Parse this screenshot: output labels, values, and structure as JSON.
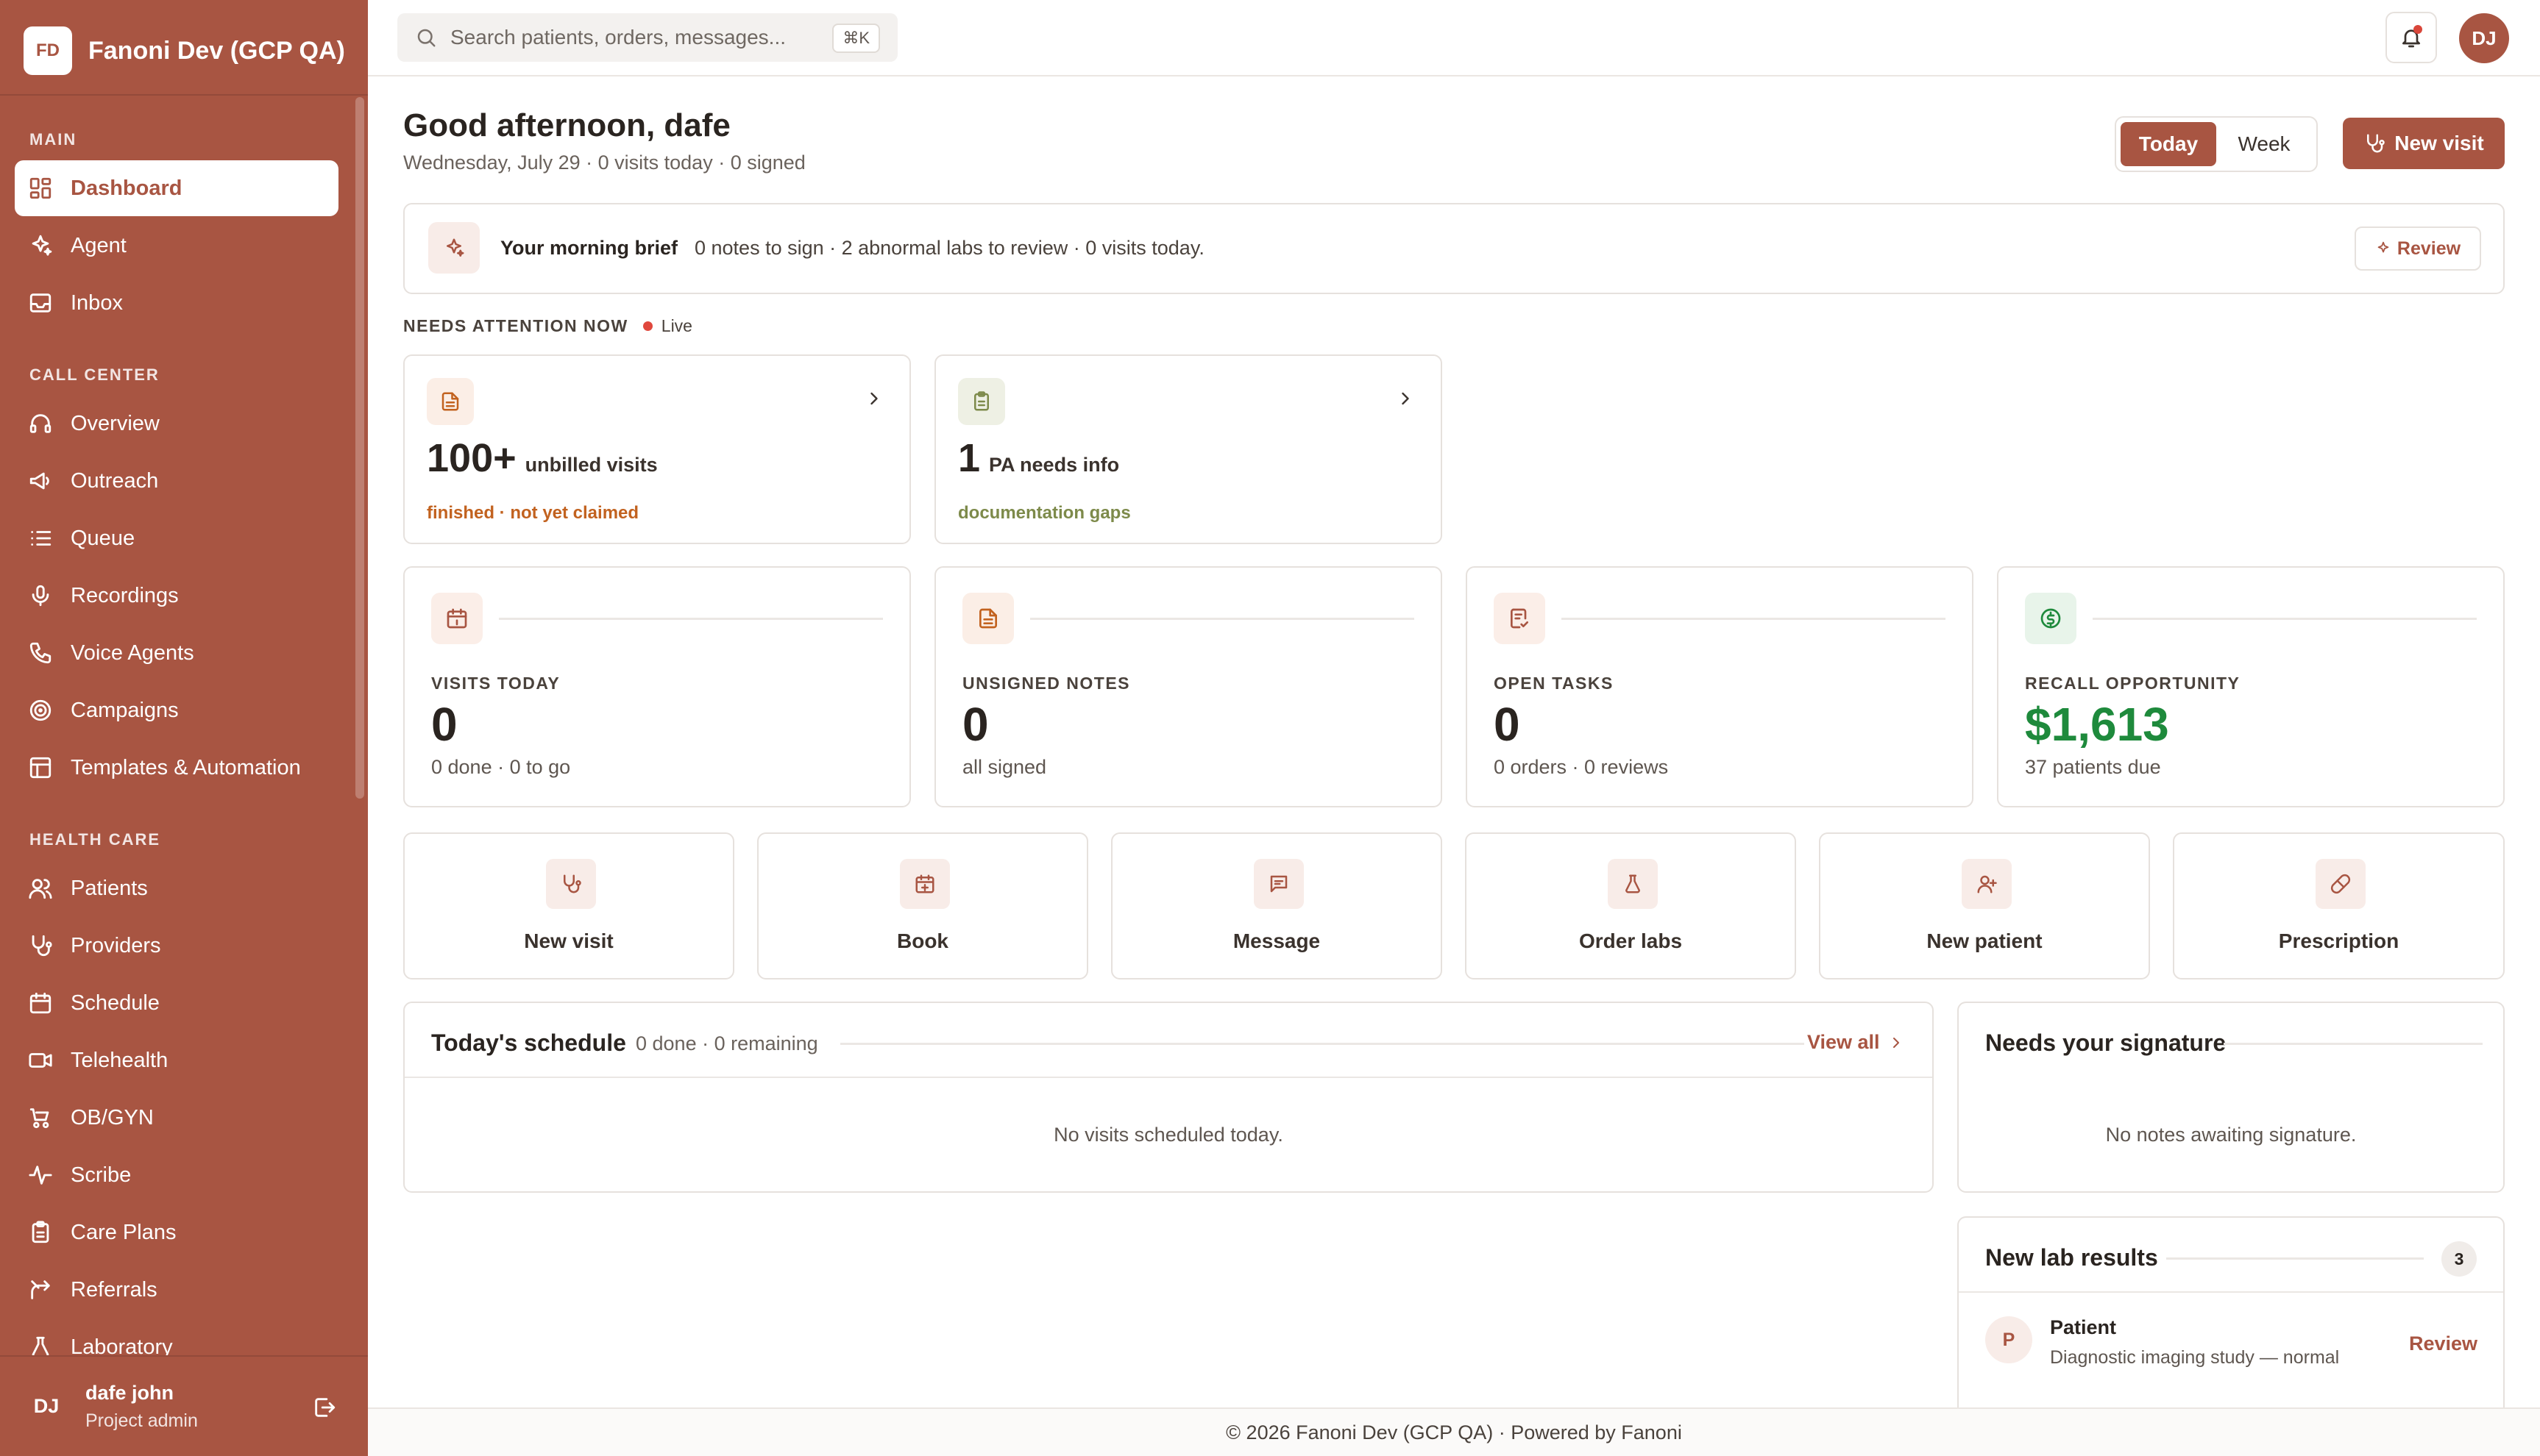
{
  "org": {
    "initials": "FD",
    "name": "Fanoni Dev (GCP QA)"
  },
  "sidebar": {
    "sections": {
      "main": "MAIN",
      "call_center": "CALL CENTER",
      "health_care": "HEALTH CARE"
    },
    "main_items": [
      {
        "label": "Dashboard",
        "icon": "dashboard-icon",
        "active": true
      },
      {
        "label": "Agent",
        "icon": "sparkle-icon"
      },
      {
        "label": "Inbox",
        "icon": "inbox-icon"
      }
    ],
    "call_items": [
      {
        "label": "Overview",
        "icon": "headset-icon"
      },
      {
        "label": "Outreach",
        "icon": "megaphone-icon"
      },
      {
        "label": "Queue",
        "icon": "list-icon"
      },
      {
        "label": "Recordings",
        "icon": "microphone-icon"
      },
      {
        "label": "Voice Agents",
        "icon": "phone-icon"
      },
      {
        "label": "Campaigns",
        "icon": "target-icon"
      },
      {
        "label": "Templates & Automation",
        "icon": "template-icon"
      }
    ],
    "health_items": [
      {
        "label": "Patients",
        "icon": "users-icon"
      },
      {
        "label": "Providers",
        "icon": "stethoscope-icon"
      },
      {
        "label": "Schedule",
        "icon": "calendar-icon"
      },
      {
        "label": "Telehealth",
        "icon": "video-icon"
      },
      {
        "label": "OB/GYN",
        "icon": "stroller-icon"
      },
      {
        "label": "Scribe",
        "icon": "waveform-icon"
      },
      {
        "label": "Care Plans",
        "icon": "clipboard-icon"
      },
      {
        "label": "Referrals",
        "icon": "split-arrow-icon"
      },
      {
        "label": "Laboratory",
        "icon": "flask-icon"
      }
    ]
  },
  "user": {
    "initials": "DJ",
    "name": "dafe john",
    "role": "Project admin"
  },
  "topbar": {
    "search_placeholder": "Search patients, orders, messages...",
    "shortcut": "⌘K",
    "avatar": "DJ"
  },
  "header": {
    "greeting": "Good afternoon, dafe",
    "subtitle": "Wednesday, July 29 · 0 visits today · 0 signed",
    "range_today": "Today",
    "range_week": "Week",
    "new_visit": "New visit"
  },
  "brief": {
    "title": "Your morning brief",
    "text": "0 notes to sign · 2 abnormal labs to review · 0 visits today.",
    "review": "Review"
  },
  "attention": {
    "label": "NEEDS ATTENTION NOW",
    "live": "Live",
    "cards": [
      {
        "value": "100+",
        "label": "unbilled visits",
        "sub": "finished · not yet claimed",
        "color": "#c2621f"
      },
      {
        "value": "1",
        "label": "PA needs info",
        "sub": "documentation gaps",
        "color": "#7d8a4a"
      }
    ]
  },
  "stats": [
    {
      "label": "VISITS TODAY",
      "value": "0",
      "sub": "0 done · 0 to go"
    },
    {
      "label": "UNSIGNED NOTES",
      "value": "0",
      "sub": "all signed"
    },
    {
      "label": "OPEN TASKS",
      "value": "0",
      "sub": "0 orders · 0 reviews"
    },
    {
      "label": "RECALL OPPORTUNITY",
      "value": "$1,613",
      "sub": "37 patients due",
      "color": "#1e8a3c"
    }
  ],
  "quick_actions": [
    "New visit",
    "Book",
    "Message",
    "Order labs",
    "New patient",
    "Prescription"
  ],
  "schedule": {
    "title": "Today's schedule",
    "sub": "0 done · 0 remaining",
    "view_all": "View all",
    "empty": "No visits scheduled today."
  },
  "signature": {
    "title": "Needs your signature",
    "empty": "No notes awaiting signature."
  },
  "labs": {
    "title": "New lab results",
    "count": "3",
    "items": [
      {
        "initial": "P",
        "name": "Patient",
        "desc": "Diagnostic imaging study — normal",
        "action": "Review"
      }
    ]
  },
  "footer": "© 2026 Fanoni Dev (GCP QA) · Powered by Fanoni"
}
